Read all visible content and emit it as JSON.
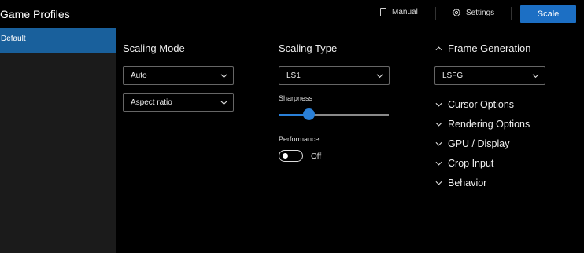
{
  "header": {
    "title": "Game Profiles",
    "manual_label": "Manual",
    "settings_label": "Settings",
    "scale_label": "Scale"
  },
  "sidebar": {
    "items": [
      {
        "label": "Default",
        "selected": true
      }
    ]
  },
  "scaling_mode": {
    "title": "Scaling Mode",
    "mode_value": "Auto",
    "aspect_value": "Aspect ratio"
  },
  "scaling_type": {
    "title": "Scaling Type",
    "type_value": "LS1",
    "sharpness_label": "Sharpness",
    "sharpness_level": 0.27,
    "performance_label": "Performance",
    "performance_state": "Off"
  },
  "frame_generation": {
    "title": "Frame Generation",
    "value": "LSFG"
  },
  "sections": [
    {
      "label": "Cursor Options"
    },
    {
      "label": "Rendering Options"
    },
    {
      "label": "GPU / Display"
    },
    {
      "label": "Crop Input"
    },
    {
      "label": "Behavior"
    }
  ],
  "colors": {
    "accent": "#1c6fc4",
    "selected_item": "#19609c",
    "sidebar_bg": "#1b1b1b",
    "background": "#000000"
  }
}
